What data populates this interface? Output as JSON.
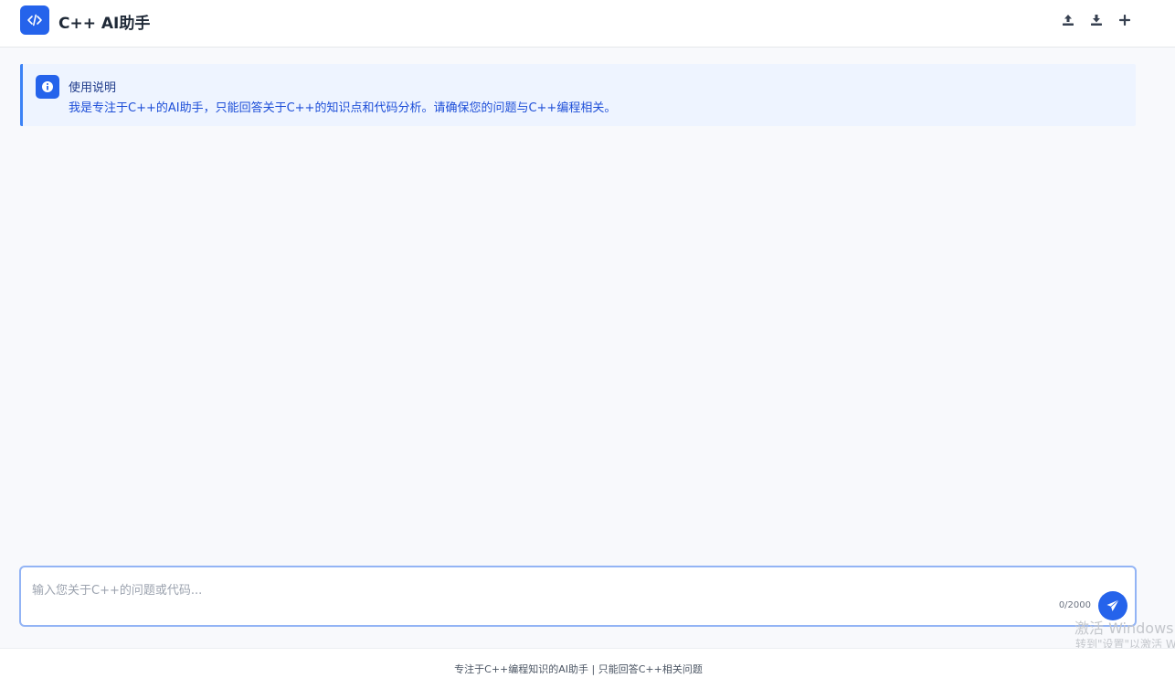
{
  "header": {
    "title": "C++ AI助手",
    "logo_icon": "code-icon",
    "actions": [
      {
        "name": "upload-button",
        "icon": "upload-icon"
      },
      {
        "name": "download-button",
        "icon": "download-icon"
      },
      {
        "name": "new-chat-button",
        "icon": "plus-icon"
      }
    ]
  },
  "notice": {
    "icon": "info-icon",
    "title": "使用说明",
    "text": "我是专注于C++的AI助手，只能回答关于C++的知识点和代码分析。请确保您的问题与C++编程相关。"
  },
  "input": {
    "placeholder": "输入您关于C++的问题或代码...",
    "value": "",
    "counter": "0/2000",
    "send_icon": "send-icon"
  },
  "watermark": {
    "line1": "激活 Windows",
    "line2": "转到\"设置\"以激活 W"
  },
  "footer": {
    "text": "专注于C++编程知识的AI助手 | 只能回答C++相关问题"
  },
  "colors": {
    "accent": "#2563eb",
    "notice_bg": "#eef4ff",
    "notice_border": "#3b82f6",
    "page_bg": "#f8f9fc"
  }
}
